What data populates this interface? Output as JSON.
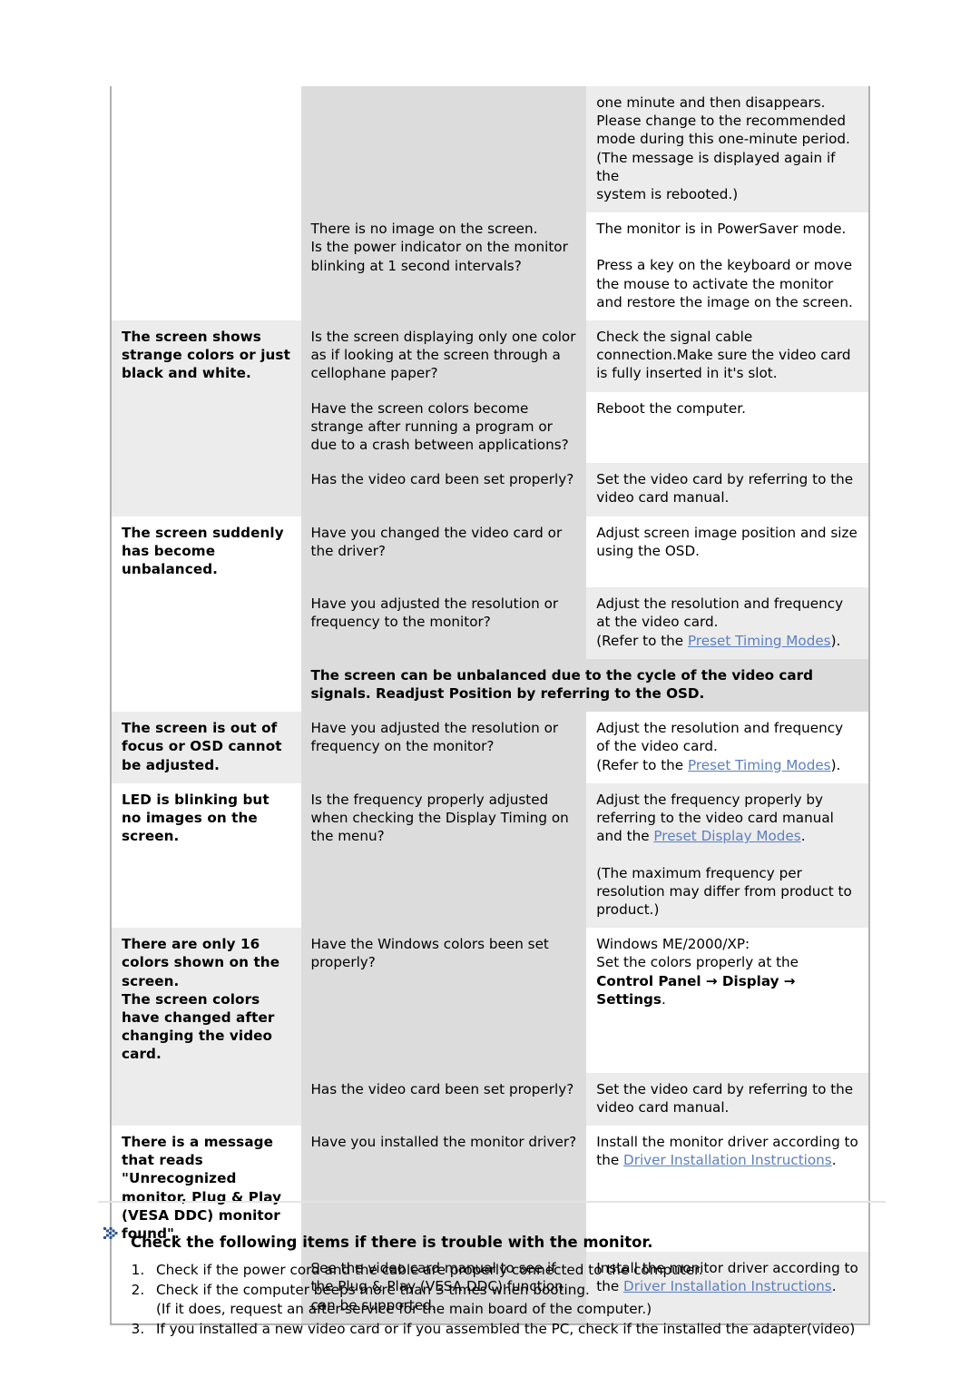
{
  "table": {
    "columns": [
      "symptom",
      "checklist",
      "solution"
    ],
    "rows": [
      {
        "symptom": "",
        "symptom_bg": "white",
        "checklist": "",
        "checklist_bg": "mid",
        "solution_lines": [
          "one minute and then disappears.",
          "Please change to the recommended",
          "mode during this one-minute period.",
          "(The message is displayed again if the",
          "system is rebooted.)"
        ],
        "solution_bg": "light"
      },
      {
        "symptom": "",
        "symptom_bg": "white",
        "checklist": "There is no image on the screen.\nIs the power indicator on the monitor blinking at 1 second intervals?",
        "checklist_bg": "mid",
        "solution_p1": "The monitor is in PowerSaver mode.",
        "solution_p2": "Press a key on the keyboard or move the mouse to activate the monitor and restore the image on the screen.",
        "solution_bg": "white"
      },
      {
        "symptom": "The screen shows strange colors or just black and white.",
        "symptom_bg": "light",
        "checklist": "Is the screen displaying only one color as if looking at the screen through a cellophane paper?",
        "checklist_bg": "mid",
        "solution": "Check the signal cable connection.Make sure the video card is fully inserted in it's slot.",
        "solution_bg": "light"
      },
      {
        "symptom": "",
        "symptom_bg": "light",
        "checklist": "Have the screen colors become strange after running a program or due to a crash between applications?",
        "checklist_bg": "mid",
        "solution": "Reboot the computer.",
        "solution_bg": "white"
      },
      {
        "symptom": "",
        "symptom_bg": "light",
        "checklist": "Has the video card been set properly?",
        "checklist_bg": "mid",
        "solution": "Set the video card by referring to the video card manual.",
        "solution_bg": "light"
      },
      {
        "symptom": "The screen suddenly has become unbalanced.",
        "symptom_bg": "white",
        "checklist": "Have you changed the video card or the driver?",
        "checklist_bg": "mid",
        "solution": "Adjust screen image position and size using the OSD.",
        "solution_bg": "white"
      },
      {
        "symptom": "",
        "symptom_bg": "white",
        "checklist": "Have you adjusted the resolution or frequency to the monitor?",
        "checklist_bg": "mid",
        "solution_pre": "Adjust the resolution and frequency at the video card.",
        "solution_refer_prefix": "(Refer to the ",
        "solution_link": "Preset Timing Modes",
        "solution_refer_suffix": ").",
        "solution_bg": "light"
      },
      {
        "note": "The screen can be unbalanced due to the cycle of the video card signals. Readjust Position by referring to the OSD.",
        "note_bg": "mid",
        "symptom_bg": "white",
        "span": 2
      },
      {
        "symptom": "The screen is out of focus or OSD cannot be adjusted.",
        "symptom_bg": "light",
        "checklist": "Have you adjusted the resolution or frequency on the monitor?",
        "checklist_bg": "mid",
        "solution_pre": "Adjust the resolution and frequency of the video card.",
        "solution_refer_prefix": "(Refer to the ",
        "solution_link": "Preset Timing Modes",
        "solution_refer_suffix": ").",
        "solution_bg": "white"
      },
      {
        "symptom": "LED is blinking but no images on the screen.",
        "symptom_bg": "white",
        "checklist": "Is the frequency properly adjusted when checking the Display Timing on the menu?",
        "checklist_bg": "mid",
        "solution_pre": "Adjust the frequency properly by referring to the video card manual and the ",
        "solution_link2": "Preset Display Modes",
        "solution_post": ".",
        "solution_p2": "(The maximum frequency per resolution may differ from product to product.)",
        "solution_bg": "light"
      },
      {
        "symptom": "There are only 16 colors shown on the screen.\nThe screen colors have changed after changing the video card.",
        "symptom_bg": "light",
        "checklist": "Have the Windows colors been set properly?",
        "checklist_bg": "mid",
        "solution_l1": "Windows ME/2000/XP:",
        "solution_l2_pre": "Set the colors properly at the ",
        "solution_l2_bold": "Control Panel → Display → Settings",
        "solution_l2_post": ".",
        "solution_bg": "white"
      },
      {
        "symptom": "",
        "symptom_bg": "light",
        "checklist": "Has the video card been set properly?",
        "checklist_bg": "mid",
        "solution": "Set the video card by referring to the video card manual.",
        "solution_bg": "light"
      },
      {
        "symptom": "There is a message that reads \"Unrecognized monitor, Plug & Play (VESA DDC) monitor found\".",
        "symptom_bg": "white",
        "checklist": "Have you installed the monitor driver?",
        "checklist_bg": "mid",
        "solution_pre": "Install the monitor driver according to the ",
        "solution_link2": "Driver Installation Instructions",
        "solution_post": ".",
        "solution_bg": "white"
      },
      {
        "symptom": "",
        "symptom_bg": "white",
        "checklist": "See the video card manual to see if the Plug & Play (VESA DDC) function can be supported.",
        "checklist_bg": "mid",
        "solution_pre": "Install the monitor driver according to the ",
        "solution_link2": "Driver Installation Instructions",
        "solution_post": ".",
        "solution_bg": "light"
      }
    ]
  },
  "notice": {
    "icon": "double-chevron-right-icon",
    "title": "Check the following items if there is trouble with the monitor.",
    "steps": [
      {
        "text": "Check if the power cord and the cable are properly connected to the computer."
      },
      {
        "text": "Check if the computer beeps more than 3 times when booting.",
        "sub": "(If it does, request an after-service for the main board of the computer.)"
      },
      {
        "text": "If you installed a new video card or if you assembled the PC, check if the installed the adapter(video)"
      }
    ]
  },
  "colors": {
    "link": "#5b7fbe",
    "cell_light": "#ececec",
    "cell_mid": "#dcdcdc",
    "border": "#b0b0b0",
    "rule": "#e4e4e4",
    "icon_blue": "#2e5596"
  }
}
